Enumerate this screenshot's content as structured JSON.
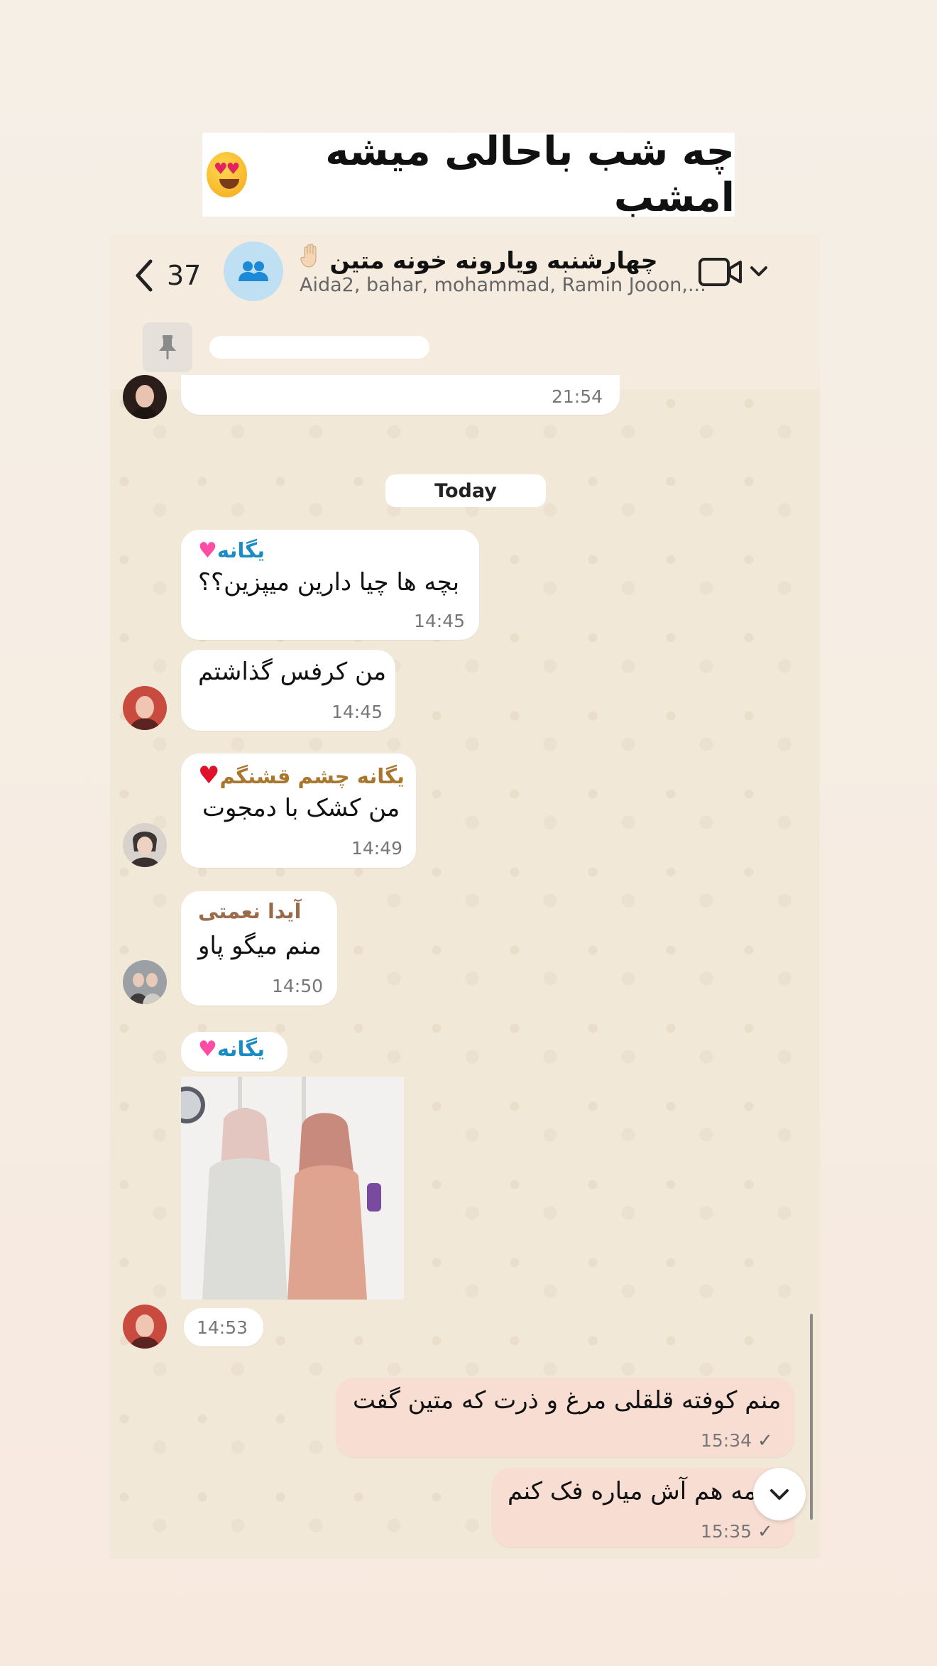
{
  "caption": {
    "text": "چه شب باحالی میشه امشب",
    "emoji": "heart-eyes-emoji"
  },
  "header": {
    "unread_count": "37",
    "group_title": "چهارشنبه ویارونه خونه متین",
    "members": "Aida2, bahar, mohammad, Ramin Jooon,...",
    "icons": [
      "back-chevron-icon",
      "group-icon",
      "raised-hand-emoji",
      "video-call-icon",
      "chevron-down-icon"
    ]
  },
  "pinned": {
    "icon": "pin-icon"
  },
  "messages": {
    "prev_time": "21:54",
    "date_divider": "Today",
    "m1": {
      "sender": "یگانه",
      "text": "بچه ها چیا دارین میپزین؟؟",
      "time": "14:45"
    },
    "m2": {
      "text": "من کرفس گذاشتم",
      "time": "14:45"
    },
    "m3": {
      "sender": "یگانه چشم قشنگم",
      "text": "من کشک با دمجوت",
      "time": "14:49"
    },
    "m4": {
      "sender": "آیدا نعمتی",
      "text": "منم میگو پاو",
      "time": "14:50"
    },
    "m5": {
      "sender": "یگانه",
      "time": "14:53"
    },
    "out1": {
      "text": "منم کوفته قلقلی مرغ و ذرت که متین گفت",
      "time": "15:34"
    },
    "out2": {
      "text": "مه هم آش میاره فک کنم",
      "time": "15:35"
    }
  },
  "colors": {
    "sender_blue": "#1b8bc4",
    "sender_gold": "#a9762e",
    "sender_brown": "#9a6b4a",
    "outgoing_bubble": "#f7ddd2",
    "incoming_bubble": "#ffffff"
  }
}
